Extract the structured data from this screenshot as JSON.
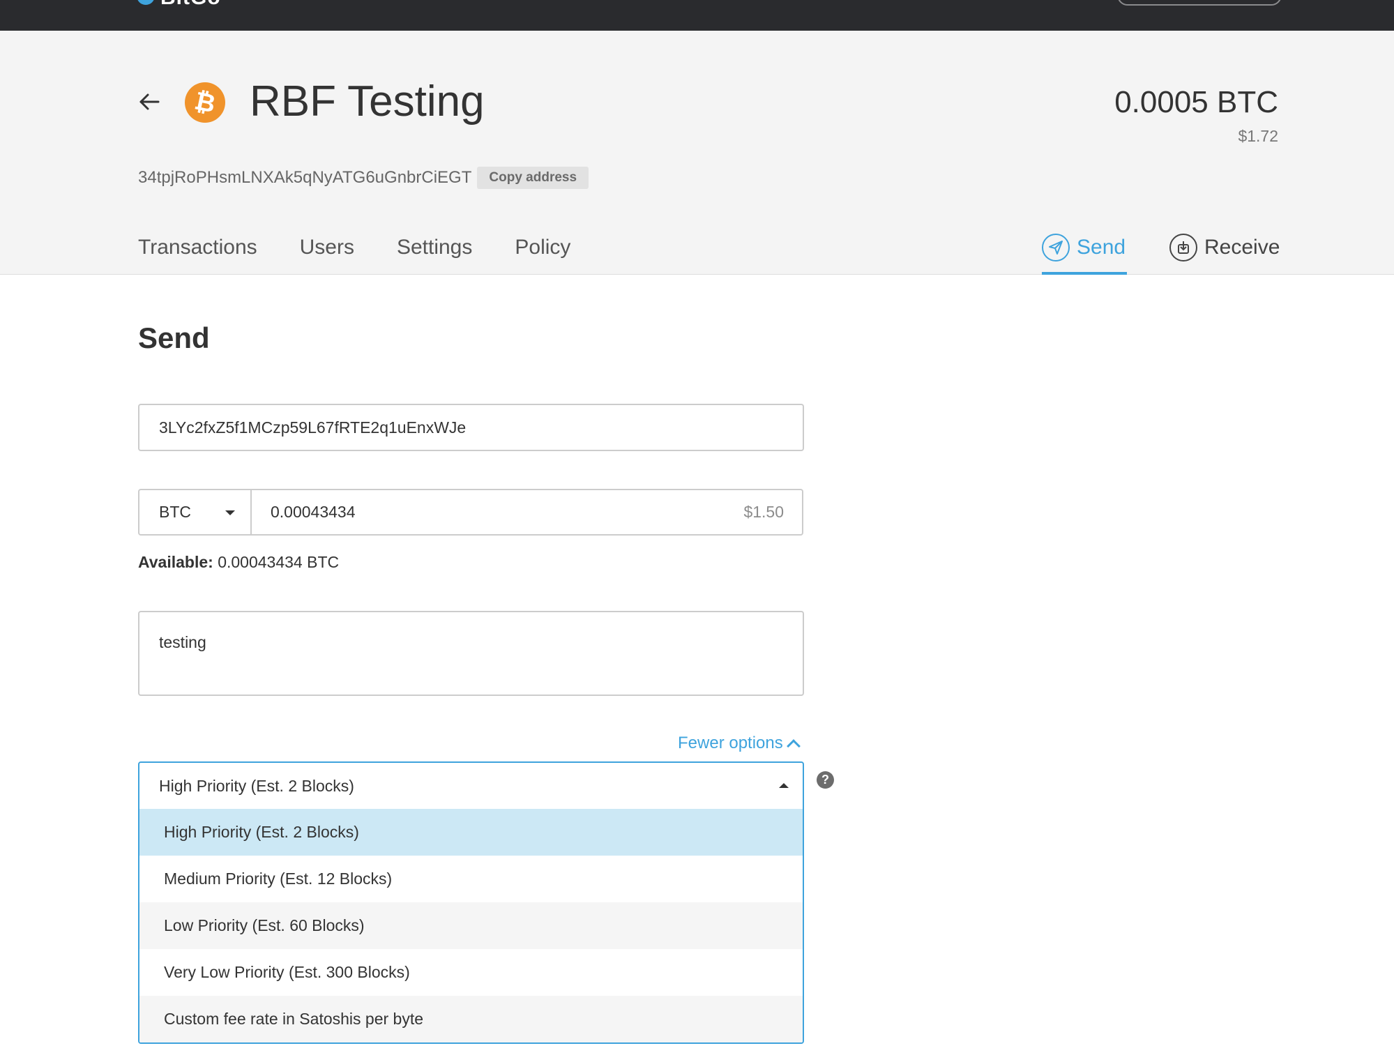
{
  "app": {
    "brand": "BitGo"
  },
  "wallet": {
    "name": "RBF Testing",
    "balance_btc": "0.0005 BTC",
    "balance_usd": "$1.72",
    "address": "34tpjRoPHsmLNXAk5qNyATG6uGnbrCiEGT",
    "copy_label": "Copy address",
    "coin_icon": "bitcoin-icon"
  },
  "tabs": [
    {
      "label": "Transactions"
    },
    {
      "label": "Users"
    },
    {
      "label": "Settings"
    },
    {
      "label": "Policy"
    }
  ],
  "actions": {
    "send_label": "Send",
    "receive_label": "Receive",
    "active": "send"
  },
  "send_form": {
    "title": "Send",
    "recipient_address": "3LYc2fxZ5f1MCzp59L67fRTE2q1uEnxWJe",
    "currency": "BTC",
    "amount": "0.00043434",
    "amount_usd": "$1.50",
    "available_label": "Available:",
    "available_value": "0.00043434 BTC",
    "memo": "testing",
    "fewer_options_label": "Fewer options",
    "fee_selected": "High Priority (Est. 2 Blocks)",
    "fee_options": [
      "High Priority (Est. 2 Blocks)",
      "Medium Priority (Est. 12 Blocks)",
      "Low Priority (Est. 60 Blocks)",
      "Very Low Priority (Est. 300 Blocks)",
      "Custom fee rate in Satoshis per byte"
    ],
    "help_glyph": "?"
  },
  "colors": {
    "accent": "#3ea3dd",
    "topbar": "#2a2b2e",
    "bitcoin": "#f0932b",
    "header_bg": "#f4f4f4",
    "option_highlight": "#cce8f5"
  }
}
